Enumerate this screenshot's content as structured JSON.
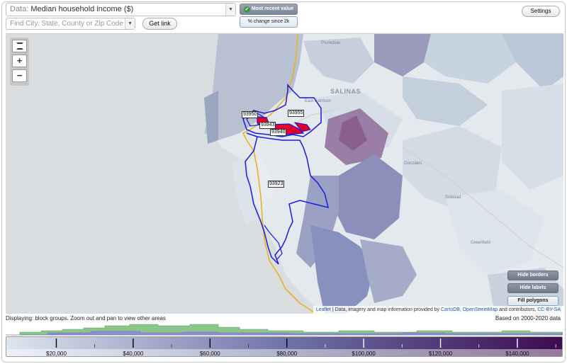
{
  "controls": {
    "data_prefix": "Data:",
    "data_value": "Median household income ($)",
    "search_placeholder": "Find City, State, County or Zip Code",
    "get_link": "Get link",
    "most_recent": "Most recent value",
    "pct_change": "% change since 2k",
    "settings": "Settings"
  },
  "map": {
    "zip_labels": [
      "93950",
      "93955",
      "93943",
      "93940",
      "93923"
    ],
    "cities": [
      "Prunedale",
      "SALINAS",
      "East Garrison",
      "Gonzales",
      "Soledad",
      "Greenfield"
    ],
    "buttons": {
      "hide_borders": "Hide borders",
      "hide_labels": "Hide labels",
      "fill_polygons": "Fill polygons"
    },
    "attribution": {
      "leaflet": "Leaflet",
      "text1": " | Data, imagery and map information provided by ",
      "carto": "CartoDB",
      "text2": ", ",
      "osm": "OpenStreetMap",
      "text3": " and contributors, ",
      "license": "CC-BY-SA"
    },
    "colors": {
      "highlight_border": "#1a1adf",
      "highway": "#e8b12a",
      "selected_fill": "#e0002a"
    }
  },
  "status": {
    "displaying": "Displaying: block groups. Zoom out and pan to view other areas",
    "based_on": "Based on 2000-2020 data"
  },
  "legend": {
    "ticks": [
      "$20,000",
      "$40,000",
      "$60,000",
      "$80,000",
      "$100,000",
      "$120,000",
      "$140,000"
    ],
    "tick_values": [
      20000,
      40000,
      60000,
      80000,
      100000,
      120000,
      140000
    ],
    "min": 7000,
    "max": 152000,
    "color_low": "#dde6ee",
    "color_mid": "#6e74a8",
    "color_high": "#3c0a50"
  }
}
